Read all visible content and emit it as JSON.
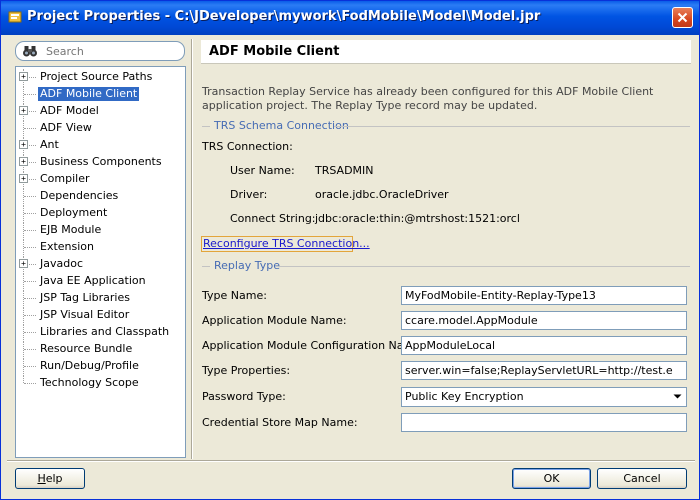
{
  "window": {
    "title": "Project Properties - C:\\JDeveloper\\mywork\\FodMobile\\Model\\Model.jpr"
  },
  "search": {
    "placeholder": "Search"
  },
  "tree": {
    "items": [
      {
        "label": "Project Source Paths",
        "expandable": true,
        "selected": false
      },
      {
        "label": "ADF Mobile Client",
        "expandable": false,
        "selected": true
      },
      {
        "label": "ADF Model",
        "expandable": true,
        "selected": false
      },
      {
        "label": "ADF View",
        "expandable": false,
        "selected": false
      },
      {
        "label": "Ant",
        "expandable": true,
        "selected": false
      },
      {
        "label": "Business Components",
        "expandable": true,
        "selected": false
      },
      {
        "label": "Compiler",
        "expandable": true,
        "selected": false
      },
      {
        "label": "Dependencies",
        "expandable": false,
        "selected": false
      },
      {
        "label": "Deployment",
        "expandable": false,
        "selected": false
      },
      {
        "label": "EJB Module",
        "expandable": false,
        "selected": false
      },
      {
        "label": "Extension",
        "expandable": false,
        "selected": false
      },
      {
        "label": "Javadoc",
        "expandable": true,
        "selected": false
      },
      {
        "label": "Java EE Application",
        "expandable": false,
        "selected": false
      },
      {
        "label": "JSP Tag Libraries",
        "expandable": false,
        "selected": false
      },
      {
        "label": "JSP Visual Editor",
        "expandable": false,
        "selected": false
      },
      {
        "label": "Libraries and Classpath",
        "expandable": false,
        "selected": false
      },
      {
        "label": "Resource Bundle",
        "expandable": false,
        "selected": false
      },
      {
        "label": "Run/Debug/Profile",
        "expandable": false,
        "selected": false
      },
      {
        "label": "Technology Scope",
        "expandable": false,
        "selected": false
      }
    ]
  },
  "panel": {
    "title": "ADF Mobile Client",
    "description": "Transaction Replay Service has already been configured for this ADF Mobile Client application project.  The Replay Type record may be updated.",
    "trs_section": "TRS Schema Connection",
    "trs_connection_label": "TRS Connection:",
    "user_name_label": "User Name:",
    "user_name_value": "TRSADMIN",
    "driver_label": "Driver:",
    "driver_value": "oracle.jdbc.OracleDriver",
    "connect_string_label": "Connect String:",
    "connect_string_value": "jdbc:oracle:thin:@mtrshost:1521:orcl",
    "reconfigure_link": "Reconfigure TRS Connection...",
    "replay_section": "Replay Type",
    "fields": [
      {
        "label": "Type Name:",
        "value": "MyFodMobile-Entity-Replay-Type13"
      },
      {
        "label": "Application Module Name:",
        "value": "ccare.model.AppModule"
      },
      {
        "label": "Application Module Configuration Name:",
        "value": "AppModuleLocal"
      },
      {
        "label": "Type Properties:",
        "value": "server.win=false;ReplayServletURL=http://test.e"
      },
      {
        "label": "Password Type:",
        "value": "Public Key Encryption"
      },
      {
        "label": "Credential Store Map Name:",
        "value": ""
      }
    ]
  },
  "buttons": {
    "help": "Help",
    "ok": "OK",
    "cancel": "Cancel"
  },
  "colors": {
    "titlebar": "#0054e3",
    "selection": "#316ac5",
    "section_label": "#466cb4",
    "link": "#1a1acc"
  }
}
